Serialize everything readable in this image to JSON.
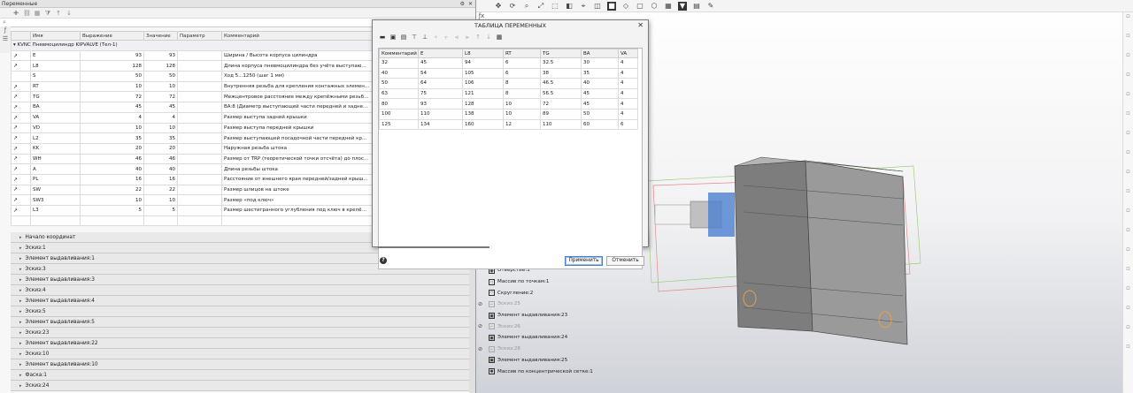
{
  "vars_panel": {
    "title": "Переменные",
    "title_controls": [
      "⚙",
      "✕"
    ],
    "search_placeholder": "",
    "columns": [
      "",
      "Имя",
      "Выражение",
      "Значение",
      "Параметр",
      "Комментарий"
    ],
    "group_label": "KVNC Пневмоцилиндр KIPVALVE (Тел-1)",
    "rows": [
      {
        "mark": "↗",
        "name": "E",
        "expr": "93",
        "value": "93",
        "param": "",
        "comment": "Ширина / Высота корпуса цилиндра"
      },
      {
        "mark": "↗",
        "name": "L8",
        "expr": "128",
        "value": "128",
        "param": "",
        "comment": "Длина корпуса пневмоцилиндра без учёта выступающих..."
      },
      {
        "mark": "",
        "name": "S",
        "expr": "50",
        "value": "50",
        "param": "",
        "comment": "Ход 5...1250 (шаг 1 мм)"
      },
      {
        "mark": "↗",
        "name": "RT",
        "expr": "10",
        "value": "10",
        "param": "",
        "comment": "Внутренняя резьба для крепления контажных элементов..."
      },
      {
        "mark": "↗",
        "name": "TG",
        "expr": "72",
        "value": "72",
        "param": "",
        "comment": "Межцентровое расстояние между крепёжными резьбами"
      },
      {
        "mark": "↗",
        "name": "BA",
        "expr": "45",
        "value": "45",
        "param": "",
        "comment": "BA:8 (Диаметр выступающей части передней и задней к..."
      },
      {
        "mark": "↗",
        "name": "VA",
        "expr": "4",
        "value": "4",
        "param": "",
        "comment": "Размер выступа задней крышки"
      },
      {
        "mark": "↗",
        "name": "VD",
        "expr": "10",
        "value": "10",
        "param": "",
        "comment": "Размер выступа передней крышки"
      },
      {
        "mark": "↗",
        "name": "L2",
        "expr": "35",
        "value": "35",
        "param": "",
        "comment": "Размер выступающей посадочной части передней крышк..."
      },
      {
        "mark": "↗",
        "name": "KK",
        "expr": "20",
        "value": "20",
        "param": "",
        "comment": "Наружная резьба штока"
      },
      {
        "mark": "↗",
        "name": "WH",
        "expr": "46",
        "value": "46",
        "param": "",
        "comment": "Размер от TRP (теоретической точки отсчёта) до плоскос..."
      },
      {
        "mark": "↗",
        "name": "A",
        "expr": "40",
        "value": "40",
        "param": "",
        "comment": "Длина резьбы штока"
      },
      {
        "mark": "↗",
        "name": "PL",
        "expr": "16",
        "value": "16",
        "param": "",
        "comment": "Расстояние от внешнего края передней/задней крышки д..."
      },
      {
        "mark": "↗",
        "name": "SW",
        "expr": "22",
        "value": "22",
        "param": "",
        "comment": "Размер шлицов на штоке"
      },
      {
        "mark": "↗",
        "name": "SW3",
        "expr": "10",
        "value": "10",
        "param": "",
        "comment": "Размер «под ключ»"
      },
      {
        "mark": "↗",
        "name": "L3",
        "expr": "5",
        "value": "5",
        "param": "",
        "comment": "Размер шестигранного углубления под ключ в крепёжн..."
      }
    ],
    "tree": [
      "Начало координат",
      "Эскиз:1",
      "Элемент выдавливания:1",
      "Эскиз:3",
      "Элемент выдавливания:3",
      "Эскиз:4",
      "Элемент выдавливания:4",
      "Эскиз:5",
      "Элемент выдавливания:5",
      "Эскиз:23",
      "Элемент выдавливания:22",
      "Эскиз:10",
      "Элемент выдавливания:10",
      "Фаска:1",
      "Эскиз:24"
    ]
  },
  "dialog": {
    "title": "ТАБЛИЦА ПЕРЕМЕННЫХ",
    "close": "✕",
    "columns": [
      "Комментарий",
      "E",
      "L8",
      "RT",
      "TG",
      "BA",
      "VA"
    ],
    "rows": [
      [
        "32",
        "45",
        "94",
        "6",
        "32.5",
        "30",
        "4"
      ],
      [
        "40",
        "54",
        "105",
        "6",
        "38",
        "35",
        "4"
      ],
      [
        "50",
        "64",
        "106",
        "8",
        "46.5",
        "40",
        "4"
      ],
      [
        "63",
        "75",
        "121",
        "8",
        "56.5",
        "45",
        "4"
      ],
      [
        "80",
        "93",
        "128",
        "10",
        "72",
        "45",
        "4"
      ],
      [
        "100",
        "110",
        "138",
        "10",
        "89",
        "50",
        "4"
      ],
      [
        "125",
        "134",
        "160",
        "12",
        "110",
        "60",
        "6"
      ]
    ],
    "apply": "Применить",
    "cancel": "Отменить",
    "help": "?"
  },
  "right_tree": [
    {
      "label": "Отверстие:1",
      "grey": false,
      "eye": false,
      "icon": "◉"
    },
    {
      "label": "Массив по точкам:1",
      "grey": false,
      "eye": false,
      "icon": "∷"
    },
    {
      "label": "Скругление:2",
      "grey": false,
      "eye": false,
      "icon": "◠"
    },
    {
      "label": "Эскиз:25",
      "grey": true,
      "eye": true,
      "icon": "⌐"
    },
    {
      "label": "Элемент выдавливания:23",
      "grey": false,
      "eye": false,
      "icon": "▣"
    },
    {
      "label": "Эскиз:26",
      "grey": true,
      "eye": true,
      "icon": "⌐"
    },
    {
      "label": "Элемент выдавливания:24",
      "grey": false,
      "eye": false,
      "icon": "▣"
    },
    {
      "label": "Эскиз:28",
      "grey": true,
      "eye": true,
      "icon": "⌐"
    },
    {
      "label": "Элемент выдавливания:25",
      "grey": false,
      "eye": false,
      "icon": "▣"
    },
    {
      "label": "Массив по концентрической сетке:1",
      "grey": false,
      "eye": false,
      "icon": "✺"
    }
  ],
  "colors": {
    "dialog_apply_border": "#4a7fc4",
    "model_body": "#8a8a8a",
    "highlight_orange": "#e8a04a"
  }
}
